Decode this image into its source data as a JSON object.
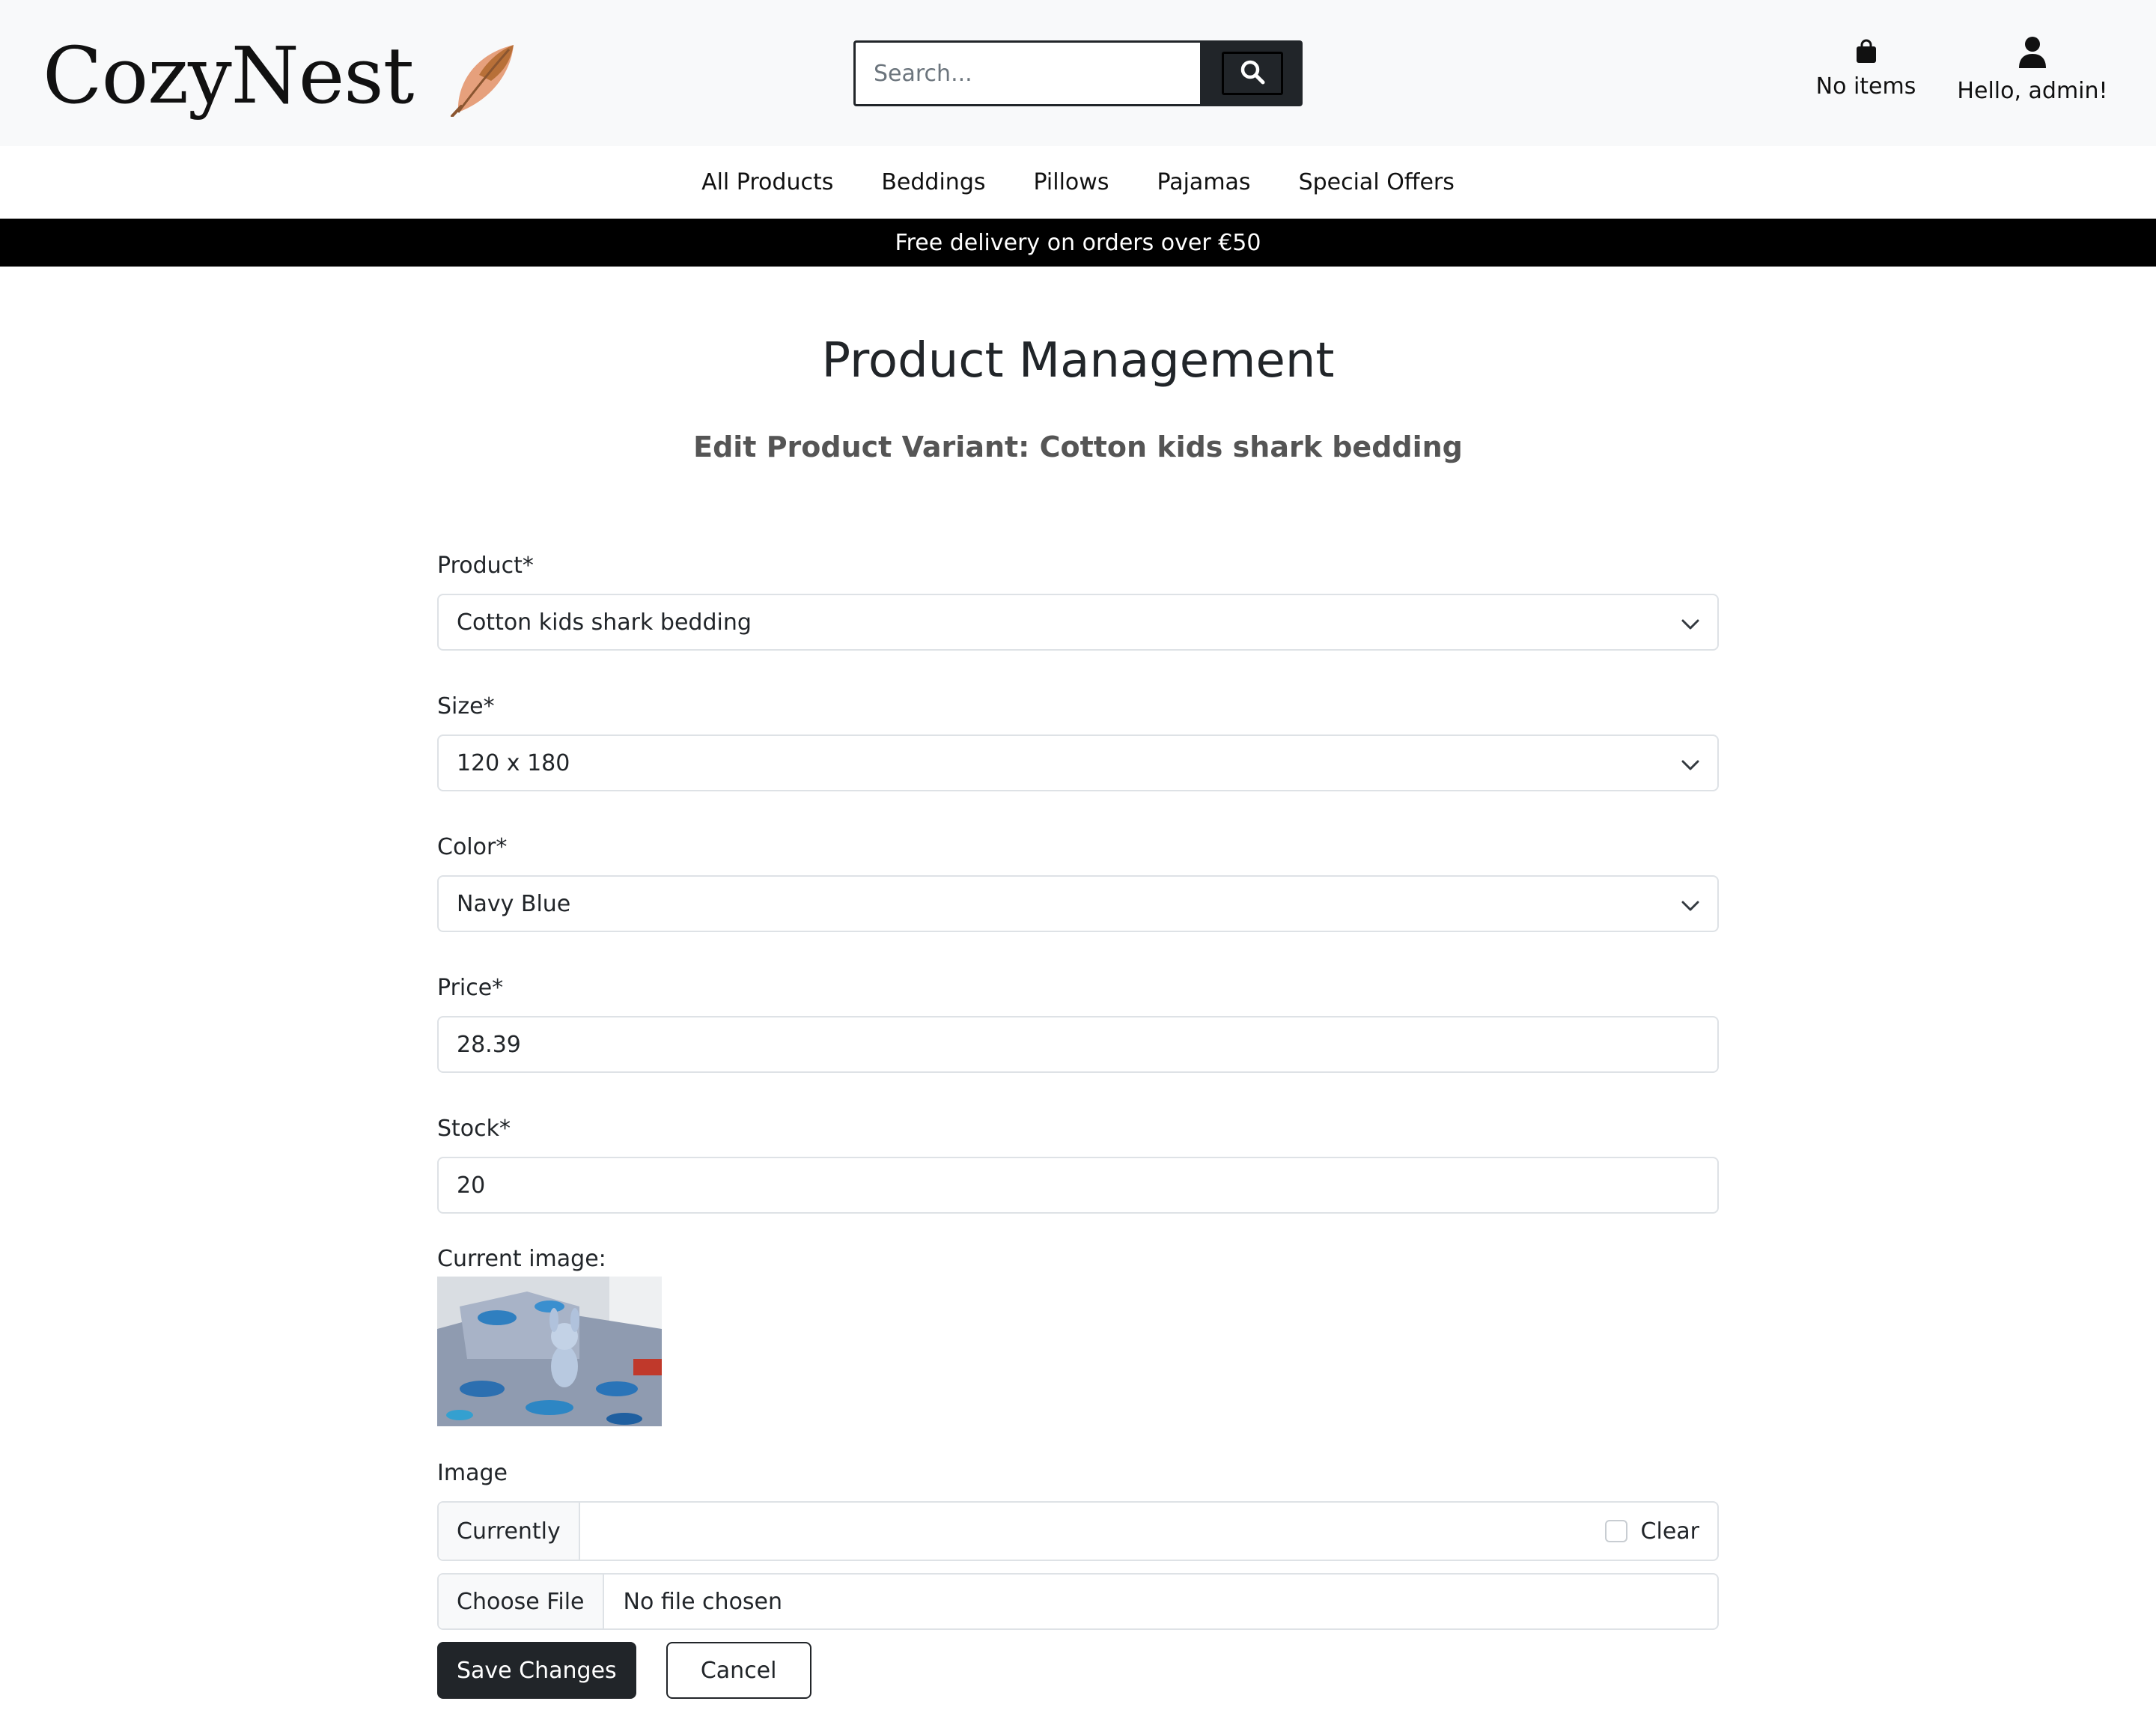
{
  "brand": {
    "name": "CozyNest",
    "logo_icon": "feather-icon"
  },
  "search": {
    "placeholder": "Search...",
    "icon": "search-icon"
  },
  "header": {
    "cart_label": "No items",
    "cart_icon": "shopping-bag-icon",
    "account_label": "Hello, admin!",
    "account_icon": "user-icon"
  },
  "nav": {
    "items": [
      "All Products",
      "Beddings",
      "Pillows",
      "Pajamas",
      "Special Offers"
    ]
  },
  "banner": {
    "text": "Free delivery on orders over €50"
  },
  "page": {
    "title": "Product Management",
    "subtitle": "Edit Product Variant: Cotton kids shark bedding"
  },
  "form": {
    "product": {
      "label": "Product*",
      "value": "Cotton kids shark bedding"
    },
    "size": {
      "label": "Size*",
      "value": "120 x 180"
    },
    "color": {
      "label": "Color*",
      "value": "Navy Blue"
    },
    "price": {
      "label": "Price*",
      "value": "28.39"
    },
    "stock": {
      "label": "Stock*",
      "value": "20"
    },
    "current_image_label": "Current image:",
    "image": {
      "label": "Image",
      "currently_label": "Currently",
      "clear_label": "Clear",
      "choose_file_label": "Choose File",
      "file_status": "No file chosen"
    },
    "save_label": "Save Changes",
    "cancel_label": "Cancel"
  },
  "colors": {
    "dark": "#212529",
    "header_bg": "#f8f9fa",
    "banner_bg": "#000000",
    "border": "#dee2e6",
    "subtitle": "#555555"
  }
}
